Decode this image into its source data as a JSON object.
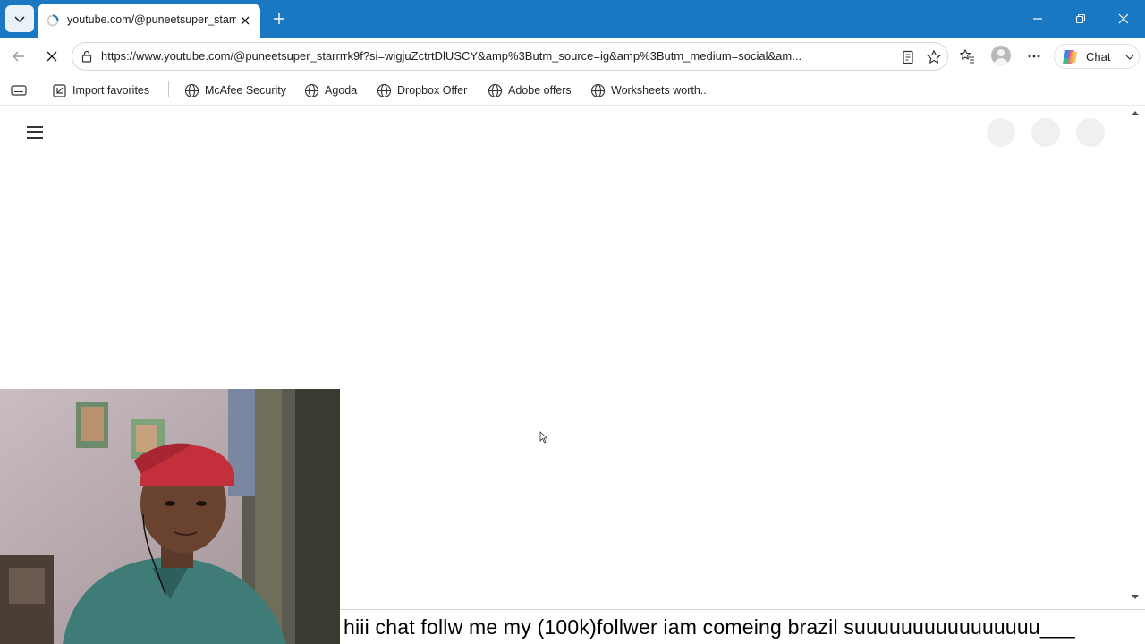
{
  "browser": {
    "tab": {
      "title": "youtube.com/@puneetsuper_starrrrk9f?si=wigjuZctrtDlUSCY"
    },
    "address": {
      "url": "https://www.youtube.com/@puneetsuper_starrrrk9f?si=wigjuZctrtDlUSCY&amp%3Butm_source=ig&amp%3Butm_medium=social&am..."
    },
    "chat_label": "Chat",
    "favorites": [
      {
        "label": "Import favorites"
      },
      {
        "label": "McAfee Security"
      },
      {
        "label": "Agoda"
      },
      {
        "label": "Dropbox Offer"
      },
      {
        "label": "Adobe offers"
      },
      {
        "label": "Worksheets worth..."
      }
    ],
    "colors": {
      "titlebar": "#1a78c2",
      "tab_active": "#ffffff",
      "page_bg": "#ffffff"
    }
  },
  "icons": [
    "tab-list-icon",
    "loading-icon",
    "close-icon",
    "plus-icon",
    "minimize-icon",
    "restore-icon",
    "back-icon",
    "stop-icon",
    "lock-icon",
    "reading-view-icon",
    "favorite-star-icon",
    "favorites-icon",
    "profile-icon",
    "more-icon",
    "copilot-icon",
    "chevron-down-icon",
    "globe-icon",
    "hamburger-menu-icon"
  ],
  "overlay": {
    "caption": "hiii chat follw me my (100k)follwer iam comeing brazil suuuuuuuuuuuuuuuu___"
  }
}
